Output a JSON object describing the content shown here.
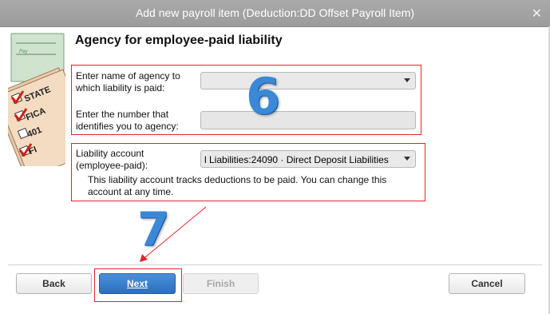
{
  "window": {
    "title": "Add new payroll item (Deduction:DD Offset Payroll Item)",
    "close_glyph": "✕"
  },
  "illustration": {
    "labels": [
      "STATE",
      "FICA",
      "401",
      "FI"
    ],
    "icon": "payroll-forms-illustration"
  },
  "page": {
    "heading": "Agency for employee-paid liability"
  },
  "agency": {
    "name_label": "Enter name of agency to which liability is paid:",
    "name_value": "",
    "number_label": "Enter the number that identifies you to agency:",
    "number_value": ""
  },
  "liability": {
    "label": "Liability account (employee-paid):",
    "selected_value": "l Liabilities:24090 · Direct Deposit Liabilities",
    "help": "This liability account tracks deductions to be paid. You can change this account at any time."
  },
  "annotations": {
    "step6": "6",
    "step7": "7",
    "color": "#e0262a",
    "number_color": "#3a88d6"
  },
  "buttons": {
    "back": "Back",
    "next": "Next",
    "finish": "Finish",
    "cancel": "Cancel"
  }
}
